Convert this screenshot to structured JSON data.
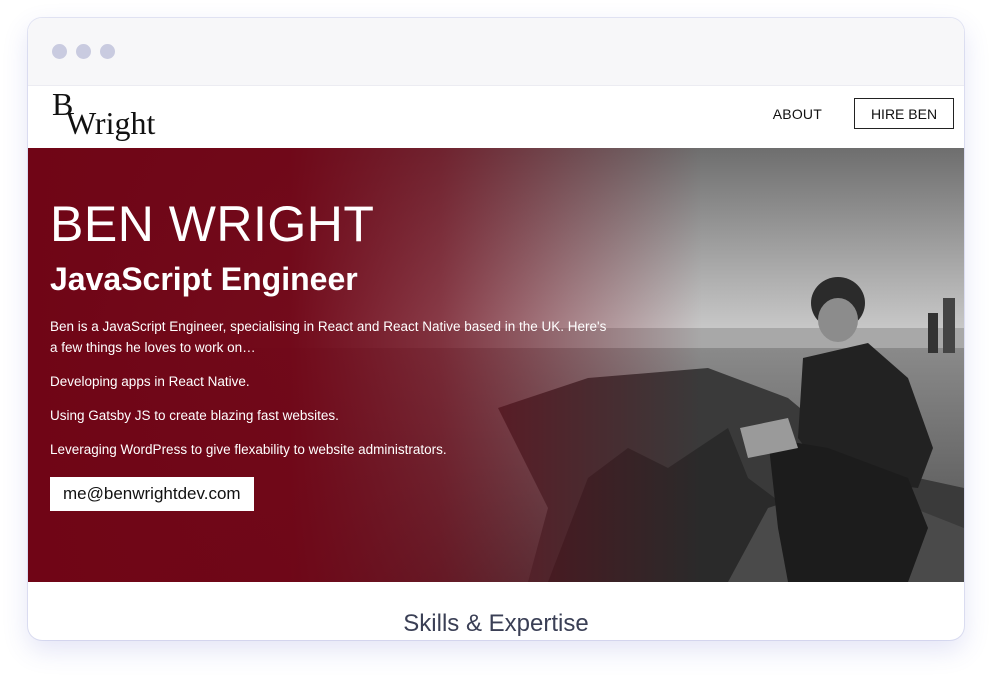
{
  "browser": {
    "dots": [
      "close",
      "minimize",
      "maximize"
    ]
  },
  "header": {
    "logo_b": "B",
    "logo_wright": "Wright",
    "nav_about": "ABOUT",
    "nav_hire": "HIRE BEN"
  },
  "hero": {
    "name": "BEN WRIGHT",
    "role": "JavaScript Engineer",
    "intro": "Ben is a JavaScript Engineer, specialising in React and React Native based in the UK. Here's a few things he loves to work on…",
    "bullets": [
      "Developing apps in React Native.",
      "Using Gatsby JS to create blazing fast websites.",
      "Leveraging WordPress to give flexability to website administrators."
    ],
    "email": "me@benwrightdev.com"
  },
  "skills": {
    "title": "Skills & Expertise"
  },
  "colors": {
    "hero_overlay": "#700516",
    "text_dark": "#3a3f55",
    "chrome": "#f7f7f9"
  }
}
